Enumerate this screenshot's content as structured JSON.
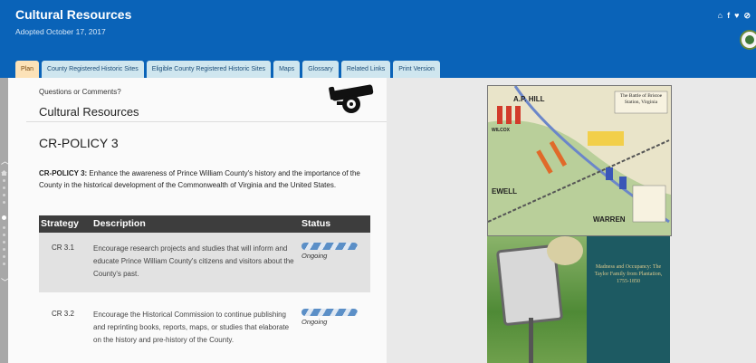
{
  "header": {
    "title": "Cultural Resources",
    "subtitle": "Adopted October 17, 2017",
    "icons": [
      "home-icon",
      "facebook-icon",
      "twitter-icon",
      "link-icon"
    ]
  },
  "tabs": [
    {
      "label": "Plan",
      "active": true
    },
    {
      "label": "County Registered Historic Sites",
      "active": false
    },
    {
      "label": "Eligible County Registered Historic Sites",
      "active": false
    },
    {
      "label": "Maps",
      "active": false
    },
    {
      "label": "Glossary",
      "active": false
    },
    {
      "label": "Related Links",
      "active": false
    },
    {
      "label": "Print Version",
      "active": false
    }
  ],
  "content": {
    "questions": "Questions or Comments?",
    "section_title": "Cultural Resources",
    "policy_title": "CR-POLICY 3",
    "policy_label": "CR-POLICY 3:",
    "policy_text": " Enhance the awareness of Prince William County's history and the importance of the County in the historical development of the Commonwealth of Virginia and the United States."
  },
  "table": {
    "headers": {
      "strategy": "Strategy",
      "description": "Description",
      "status": "Status"
    },
    "rows": [
      {
        "id": "CR 3.1",
        "description": "Encourage research projects and studies that will inform and educate Prince William County's citizens and visitors about the County's past.",
        "status": "Ongoing"
      },
      {
        "id": "CR 3.2",
        "description": "Encourage the Historical Commission to continue publishing and reprinting books, reports, maps, or studies that elaborate on the history and pre-history of the County.",
        "status": "Ongoing"
      }
    ]
  },
  "images": {
    "map": {
      "title": "The Battle of Bristoe Station, Virginia",
      "labels": {
        "hill": "A.P. HILL",
        "ewell": "EWELL",
        "warren": "WARREN",
        "wilcox": "WILCOX"
      }
    },
    "book": {
      "title": "Madness and Occupancy: The Taylor Family from Plantation, 1755-1850"
    }
  },
  "colors": {
    "header": "#0a63b8",
    "tab": "#cfe6ef",
    "active_tab": "#fce2b8",
    "table_header": "#3d3d3d"
  }
}
